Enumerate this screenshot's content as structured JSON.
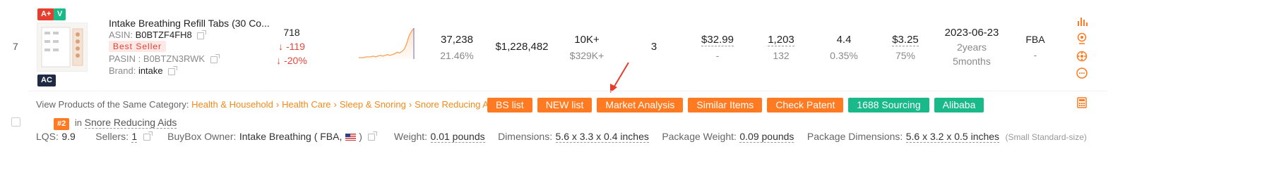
{
  "row": {
    "index": "7",
    "badges": {
      "aplus": "A+",
      "v": "V",
      "ac": "AC"
    },
    "title": "Intake Breathing Refill Tabs (30 Co...",
    "asin_label": "ASIN:",
    "asin": "B0BTZF4FH8",
    "best_seller": "Best Seller",
    "pasin_label": "PASIN :",
    "pasin": "B0BTZN3RWK",
    "brand_label": "Brand:",
    "brand": "intake",
    "rank": "718",
    "rank_change": "-119",
    "rank_change_pct": "-20%",
    "sales_units": "37,238",
    "sales_units_pct": "21.46%",
    "revenue": "$1,228,482",
    "bought": "10K+",
    "bought_revenue": "$329K+",
    "variants": "3",
    "price": "$32.99",
    "price_sub": "-",
    "ratings": "1,203",
    "ratings_sub": "132",
    "rating": "4.4",
    "rating_sub": "0.35%",
    "fee": "$3.25",
    "fee_pct": "75%",
    "date": "2023-06-23",
    "age_years": "2years",
    "age_months": "5months",
    "fulfillment": "FBA",
    "fulfillment_sub": "-"
  },
  "category": {
    "label": "View Products of the Same Category:",
    "crumbs": [
      "Health & Household",
      "Health Care",
      "Sleep & Snoring",
      "Snore Reducing Aids"
    ],
    "sep": "›"
  },
  "buttons": {
    "bs_list": "BS list",
    "new_list": "NEW list",
    "market_analysis": "Market Analysis",
    "similar_items": "Similar Items",
    "check_patent": "Check Patent",
    "sourcing": "1688 Sourcing",
    "alibaba": "Alibaba"
  },
  "rank_tag": {
    "num": "#2",
    "in": "in",
    "category": "Snore Reducing Aids"
  },
  "details": {
    "lqs_label": "LQS:",
    "lqs": "9.9",
    "sellers_label": "Sellers:",
    "sellers": "1",
    "buybox_label": "BuyBox Owner:",
    "buybox": "Intake Breathing ( FBA,",
    "weight_label": "Weight:",
    "weight": "0.01 pounds",
    "dimensions_label": "Dimensions:",
    "dimensions": "5.6 x 3.3 x 0.4 inches",
    "pkg_weight_label": "Package Weight:",
    "pkg_weight": "0.09 pounds",
    "pkg_dim_label": "Package Dimensions:",
    "pkg_dim": "5.6 x 3.2 x 0.5 inches",
    "size_tier": "(Small Standard-size)"
  },
  "sparkline": {
    "values": [
      2,
      2,
      2,
      3,
      3,
      3,
      4,
      3,
      4,
      5,
      4,
      5,
      6,
      5,
      6,
      7,
      9,
      8,
      10,
      13,
      20,
      30,
      36,
      40
    ]
  },
  "colors": {
    "accent": "#ff7a21",
    "green": "#19b98a",
    "down": "#e8463a",
    "link": "#f08a1c"
  }
}
